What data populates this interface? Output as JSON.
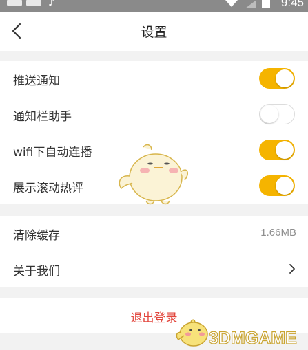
{
  "status_bar": {
    "time": "9:45"
  },
  "header": {
    "title": "设置"
  },
  "notifications_group": {
    "items": [
      {
        "label": "推送通知",
        "enabled": true
      },
      {
        "label": "通知栏助手",
        "enabled": false
      },
      {
        "label": "wifi下自动连播",
        "enabled": true
      },
      {
        "label": "展示滚动热评",
        "enabled": true
      }
    ]
  },
  "storage_group": {
    "clear_cache_label": "清除缓存",
    "cache_size": "1.66MB",
    "about_label": "关于我们"
  },
  "logout": {
    "label": "退出登录"
  },
  "watermark": {
    "text": "3DMGAME"
  },
  "colors": {
    "accent_toggle": "#f5b400",
    "logout_text": "#e2453c",
    "page_background": "#f2f2f2"
  },
  "icons": [
    "back-arrow-icon",
    "chevron-right-icon",
    "wifi-icon",
    "signal-icon",
    "battery-icon",
    "mascot-icon"
  ]
}
